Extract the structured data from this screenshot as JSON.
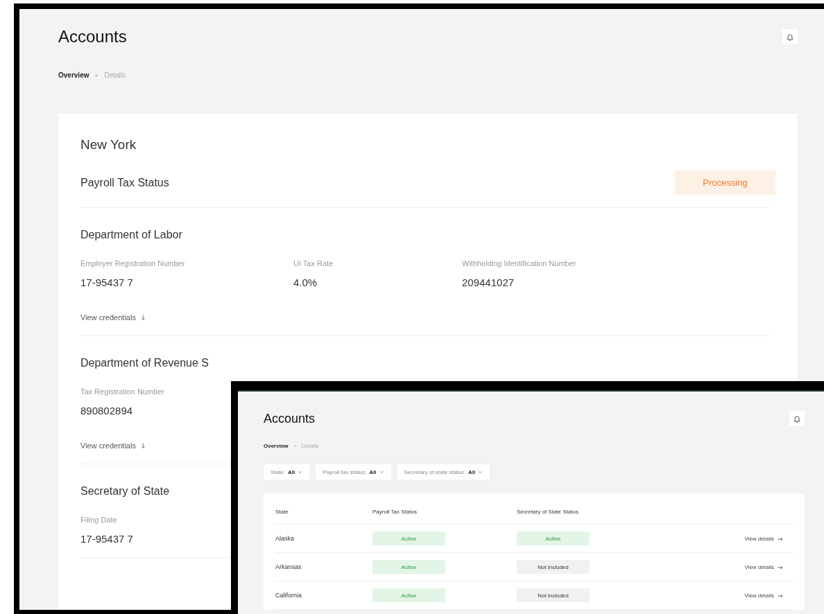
{
  "windows": [
    {
      "kind": "details",
      "title": "Accounts",
      "breadcrumb": [
        {
          "label": "Overview",
          "selected": true
        },
        {
          "label": "Details",
          "selected": false
        }
      ],
      "card": {
        "heading": "New York",
        "status_label": "Payroll Tax Status",
        "status": {
          "label": "Processing",
          "kind": "processing"
        },
        "sections": [
          {
            "title": "Department of Labor",
            "fields": [
              {
                "label": "Employer Registration Number",
                "value": "17-95437 7"
              },
              {
                "label": "UI Tax Rate",
                "value": "4.0%"
              },
              {
                "label": "Withholding Identification Number",
                "value": "209441027"
              }
            ],
            "link": "View credentials"
          },
          {
            "title": "Department of Revenue S",
            "fields": [
              {
                "label": "Tax Registration Number",
                "value": "890802894"
              }
            ],
            "link": "View credentials"
          },
          {
            "title": "Secretary of State",
            "fields": [
              {
                "label": "Filing Date",
                "value": "17-95437 7"
              }
            ]
          }
        ]
      }
    },
    {
      "kind": "list",
      "title": "Accounts",
      "breadcrumb": [
        {
          "label": "Overview",
          "selected": true
        },
        {
          "label": "Details",
          "selected": false
        }
      ],
      "filters": [
        {
          "label": "State:",
          "value": "All"
        },
        {
          "label": "Payroll tax status:",
          "value": "All"
        },
        {
          "label": "Secretary of state status:",
          "value": "All"
        }
      ],
      "table": {
        "columns": [
          "State",
          "Payroll Tax Status",
          "Secretary of State Status"
        ],
        "rows": [
          {
            "state": "Alaska",
            "payroll": {
              "label": "Active",
              "kind": "active"
            },
            "sos": {
              "label": "Active",
              "kind": "active"
            },
            "link": "View details"
          },
          {
            "state": "Arkansas",
            "payroll": {
              "label": "Active",
              "kind": "active"
            },
            "sos": {
              "label": "Not included",
              "kind": "neutral"
            },
            "link": "View details"
          },
          {
            "state": "California",
            "payroll": {
              "label": "Active",
              "kind": "active"
            },
            "sos": {
              "label": "Not included",
              "kind": "neutral"
            },
            "link": "View details"
          }
        ]
      }
    }
  ]
}
